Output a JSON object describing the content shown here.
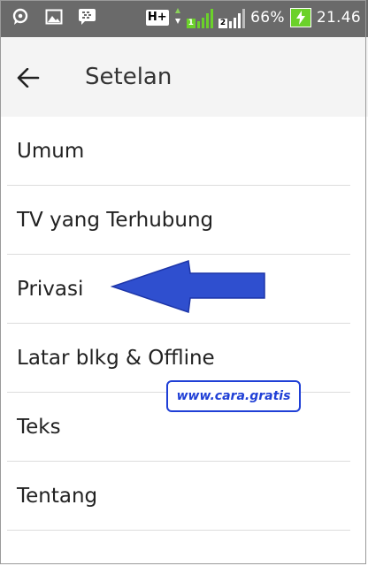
{
  "status_bar": {
    "icons_left": [
      "chat-bubble-icon",
      "image-icon",
      "bbm-icon"
    ],
    "network_type": "H+",
    "sim1_label": "1",
    "sim2_label": "2",
    "battery_percent": "66%",
    "time": "21.46",
    "colors": {
      "background": "#6a6a6a",
      "battery": "#6bd12a"
    }
  },
  "app_bar": {
    "back_icon": "arrow-back-icon",
    "title": "Setelan"
  },
  "settings": {
    "items": [
      {
        "label": "Umum"
      },
      {
        "label": "TV yang Terhubung"
      },
      {
        "label": "Privasi"
      },
      {
        "label": "Latar blkg & Offline"
      },
      {
        "label": "Teks"
      },
      {
        "label": "Tentang"
      }
    ]
  },
  "overlay": {
    "watermark": "www.cara.gratis",
    "arrow_color": "#2f4fcf"
  }
}
